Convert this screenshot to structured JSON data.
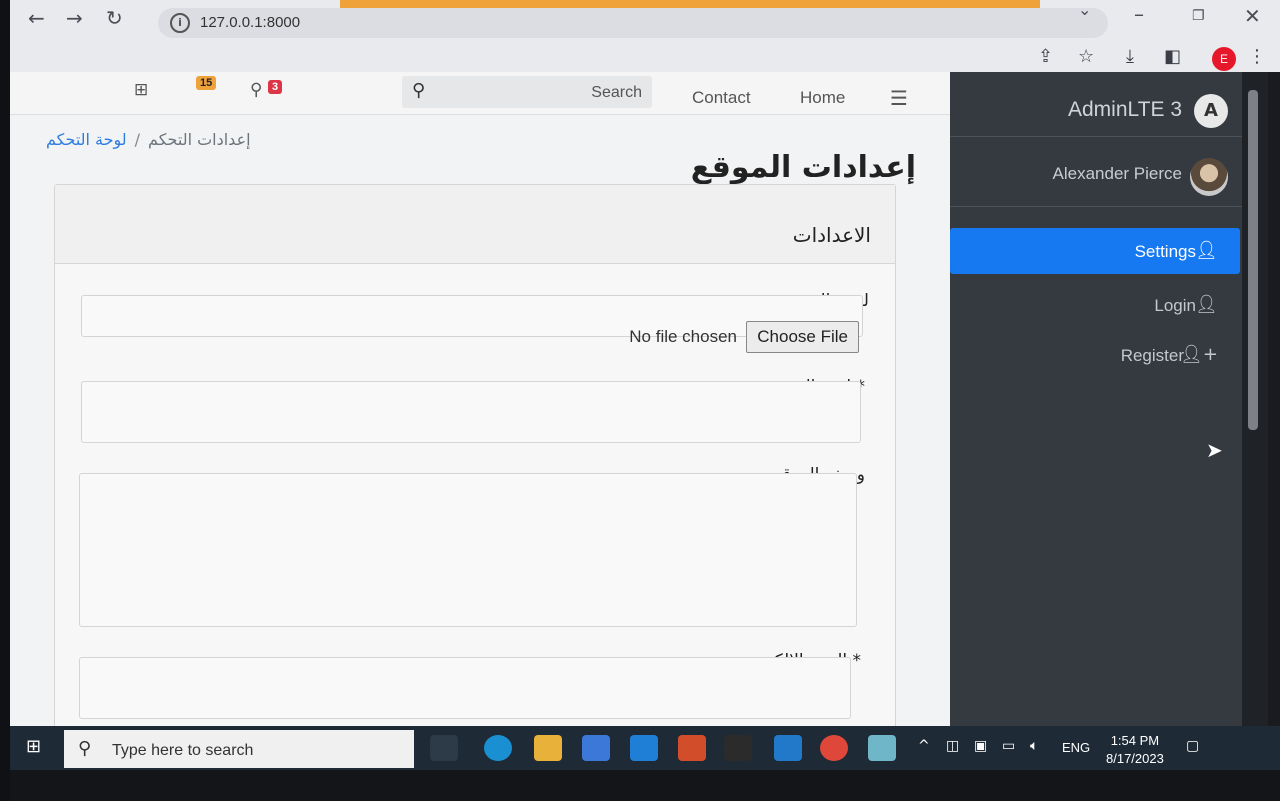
{
  "browser": {
    "url": "127.0.0.1:8000",
    "profile_initial": "E",
    "icons": [
      "back-icon",
      "forward-icon",
      "reload-icon",
      "share-icon",
      "star-icon",
      "download-icon",
      "sidepanel-icon",
      "menu-icon"
    ],
    "window_controls": [
      "minimize-icon",
      "restore-icon",
      "close-icon"
    ]
  },
  "navbar": {
    "messages_badge": "15",
    "notifications_badge": "3",
    "search_label": "Search",
    "links": [
      "Contact",
      "Home"
    ]
  },
  "breadcrumb": {
    "link": "لوحة التحكم",
    "separator": "/",
    "active": "إعدادات التحكم"
  },
  "page_title": "إعدادات الموقع",
  "card": {
    "title": "الاعدادات",
    "fields": {
      "logo_label": "لوجو الموقع",
      "file_status": "No file chosen",
      "file_button": "Choose File",
      "name_label": "* اسم الموقع",
      "description_label": "وصف الموقع",
      "email_label": "* البريد الالكتروني"
    }
  },
  "sidebar": {
    "brand": "AdminLTE 3",
    "brand_logo": "A",
    "user_name": "Alexander Pierce",
    "items": [
      {
        "label": "Settings",
        "icon": "user-icon",
        "active": true
      },
      {
        "label": "Login",
        "icon": "user-icon",
        "active": false
      },
      {
        "label": "Register",
        "icon": "user-plus-icon",
        "active": false
      }
    ]
  },
  "taskbar": {
    "search_placeholder": "Type here to search",
    "language": "ENG",
    "time": "1:54 PM",
    "date": "8/17/2023"
  },
  "colors": {
    "accent": "#1779f2",
    "sidebar_bg": "#343a40",
    "badge_orange": "#f0a23a",
    "badge_red": "#dc3545"
  }
}
